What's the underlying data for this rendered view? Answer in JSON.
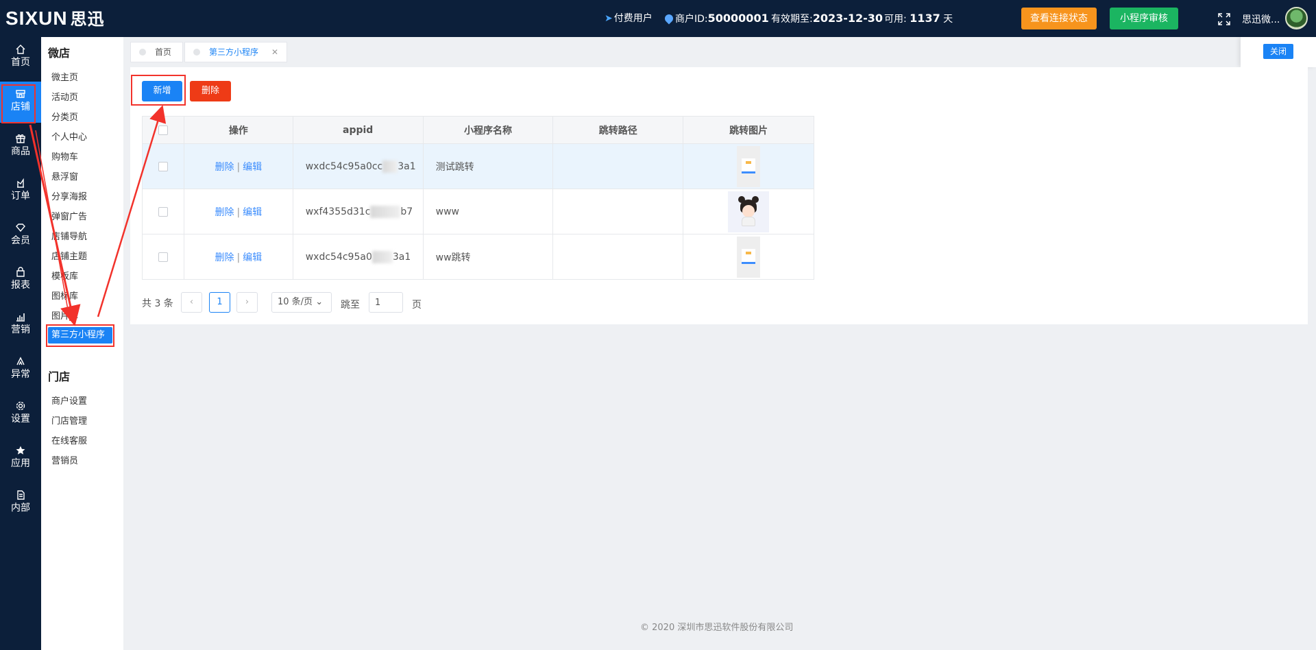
{
  "header": {
    "logo_text": "SIXUN",
    "logo_cn": "思迅",
    "paid_user": "付费用户",
    "merchant_label": "商户ID:",
    "merchant_id": "50000001",
    "valid_label": "有效期至:",
    "valid_date": "2023-12-30",
    "available_label": "可用:",
    "available_days": "1137",
    "days_unit": "天",
    "btn_connection": "查看连接状态",
    "btn_review": "小程序审核",
    "user_name": "思迅微..."
  },
  "leftnav": [
    {
      "label": "首页",
      "icon": "home-icon"
    },
    {
      "label": "店铺",
      "icon": "store-icon",
      "active": true
    },
    {
      "label": "商品",
      "icon": "gift-icon"
    },
    {
      "label": "订单",
      "icon": "order-icon"
    },
    {
      "label": "会员",
      "icon": "diamond-icon"
    },
    {
      "label": "报表",
      "icon": "bag-icon"
    },
    {
      "label": "营销",
      "icon": "chart-icon"
    },
    {
      "label": "异常",
      "icon": "warning-icon"
    },
    {
      "label": "设置",
      "icon": "gear-icon"
    },
    {
      "label": "应用",
      "icon": "star-icon"
    },
    {
      "label": "内部",
      "icon": "document-icon"
    }
  ],
  "submenu": {
    "group1_title": "微店",
    "group1_items": [
      "微主页",
      "活动页",
      "分类页",
      "个人中心",
      "购物车",
      "悬浮窗",
      "分享海报",
      "弹窗广告",
      "店铺导航",
      "店铺主题",
      "模板库",
      "图标库",
      "图片库",
      "第三方小程序"
    ],
    "group2_title": "门店",
    "group2_items": [
      "商户设置",
      "门店管理",
      "在线客服",
      "营销员"
    ]
  },
  "tabs": [
    {
      "label": "首页"
    },
    {
      "label": "第三方小程序",
      "active": true
    }
  ],
  "close_label": "关闭",
  "toolbar": {
    "add": "新增",
    "delete": "删除"
  },
  "table": {
    "columns": [
      "",
      "操作",
      "appid",
      "小程序名称",
      "跳转路径",
      "跳转图片"
    ],
    "rows": [
      {
        "appid_a": "wxdc54c95a0cc",
        "appid_b": "3a1",
        "name": "测试跳转",
        "path": "",
        "action_delete": "删除",
        "action_edit": "编辑",
        "image": "card"
      },
      {
        "appid_a": "wxf4355d31c",
        "appid_b": "b7",
        "name": "www",
        "path": "",
        "action_delete": "删除",
        "action_edit": "编辑",
        "image": "girl"
      },
      {
        "appid_a": "wxdc54c95a0",
        "appid_b": "3a1",
        "name": "ww跳转",
        "path": "",
        "action_delete": "删除",
        "action_edit": "编辑",
        "image": "card"
      }
    ]
  },
  "pagination": {
    "total": "共 3 条",
    "current": "1",
    "page_size": "10 条/页",
    "goto_label": "跳至",
    "goto_value": "1",
    "page_unit": "页",
    "prev": "‹",
    "next": "›"
  },
  "footer": "© 2020 深圳市思迅软件股份有限公司",
  "colors": {
    "topbar_bg": "#0c1f3a",
    "primary": "#1a83f5",
    "danger": "#ee3b16",
    "orange": "#f7941d",
    "green": "#1bb561",
    "annotation_red": "#f2322b"
  }
}
